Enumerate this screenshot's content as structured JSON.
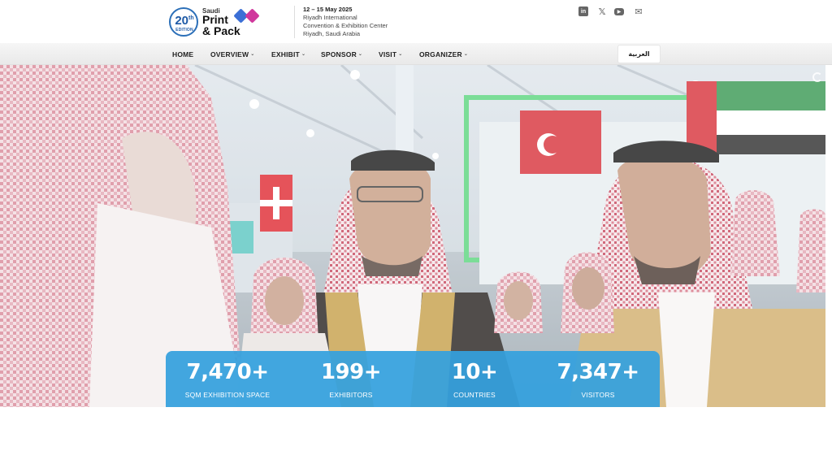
{
  "header": {
    "logo": {
      "edition_number": "20",
      "edition_suffix": "th",
      "edition_word": "EDITION",
      "line1": "Saudi",
      "line2": "Print",
      "line3": "& Pack"
    },
    "event": {
      "date": "12 – 15 May 2025",
      "venue_lines": [
        "Riyadh International",
        "Convention & Exhibition Center",
        "Riyadh, Saudi Arabia"
      ]
    },
    "socials": [
      {
        "icon": "linkedin-icon",
        "glyph": "in"
      },
      {
        "icon": "x-icon",
        "glyph": "𝕏"
      },
      {
        "icon": "youtube-icon",
        "glyph": "▶"
      },
      {
        "icon": "mail-icon",
        "glyph": "✉"
      }
    ]
  },
  "nav": {
    "items": [
      {
        "label": "HOME",
        "dropdown": false
      },
      {
        "label": "OVERVIEW",
        "dropdown": true
      },
      {
        "label": "EXHIBIT",
        "dropdown": true
      },
      {
        "label": "SPONSOR",
        "dropdown": true
      },
      {
        "label": "VISIT",
        "dropdown": true
      },
      {
        "label": "ORGANIZER",
        "dropdown": true
      }
    ],
    "chevron": "⌄",
    "language_button": "العربية"
  },
  "stats": [
    {
      "value": "7,470+",
      "label": "SQM EXHIBITION SPACE"
    },
    {
      "value": "199+",
      "label": "EXHIBITORS"
    },
    {
      "value": "10+",
      "label": "COUNTRIES"
    },
    {
      "value": "7,347+",
      "label": "VISITORS"
    }
  ],
  "colors": {
    "stats_panel": "#34a0de",
    "brand_blue": "#1e5aa6",
    "brand_magenta": "#d0379c"
  }
}
